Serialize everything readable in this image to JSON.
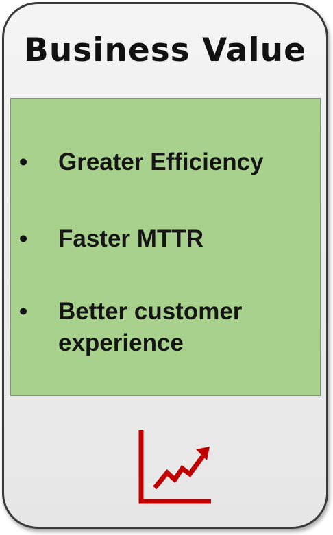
{
  "card": {
    "title": "Business Value",
    "items": [
      {
        "bullet": "•",
        "text": "Greater Efficiency"
      },
      {
        "bullet": "•",
        "text": "Faster MTTR"
      },
      {
        "bullet": "•",
        "text": "Better customer experience"
      }
    ],
    "icon": "trending-up-chart-icon",
    "colors": {
      "panel": "#a9d18e",
      "icon": "#c00000",
      "border": "#3a3a3a"
    }
  }
}
